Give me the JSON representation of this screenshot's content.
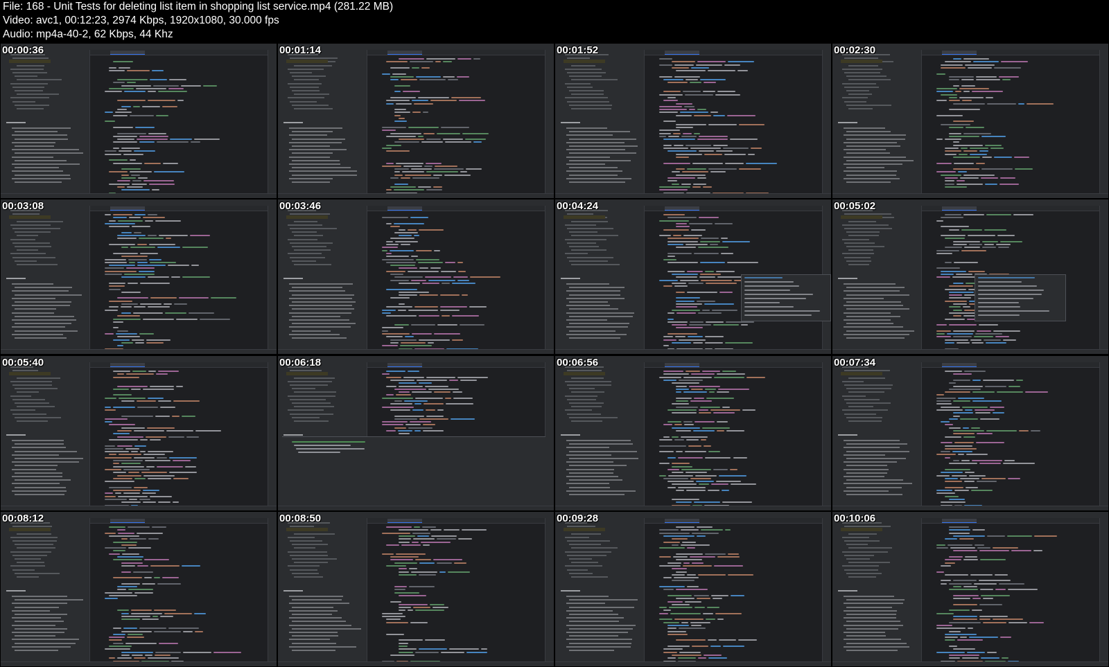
{
  "header": {
    "file_line": "File: 168 - Unit Tests for deleting list item in shopping list service.mp4 (281.22 MB)",
    "video_line": "Video: avc1, 00:12:23, 2974 Kbps, 1920x1080, 30.000 fps",
    "audio_line": "Audio: mp4a-40-2, 62 Kbps, 44 Khz"
  },
  "thumbnails": [
    {
      "timestamp": "00:00:36"
    },
    {
      "timestamp": "00:01:14"
    },
    {
      "timestamp": "00:01:52"
    },
    {
      "timestamp": "00:02:30"
    },
    {
      "timestamp": "00:03:08"
    },
    {
      "timestamp": "00:03:46"
    },
    {
      "timestamp": "00:04:24"
    },
    {
      "timestamp": "00:05:02"
    },
    {
      "timestamp": "00:05:40"
    },
    {
      "timestamp": "00:06:18"
    },
    {
      "timestamp": "00:06:56"
    },
    {
      "timestamp": "00:07:34"
    },
    {
      "timestamp": "00:08:12"
    },
    {
      "timestamp": "00:08:50"
    },
    {
      "timestamp": "00:09:28"
    },
    {
      "timestamp": "00:10:06"
    }
  ],
  "colors": {
    "background": "#000000",
    "ide_editor": "#1e1f22",
    "ide_panel": "#2b2d30",
    "accent_blue": "#3574f0",
    "keyword_orange": "#cf8e6d",
    "string_green": "#6aab73",
    "function_blue": "#56a8f5",
    "property_purple": "#c77dbb"
  }
}
